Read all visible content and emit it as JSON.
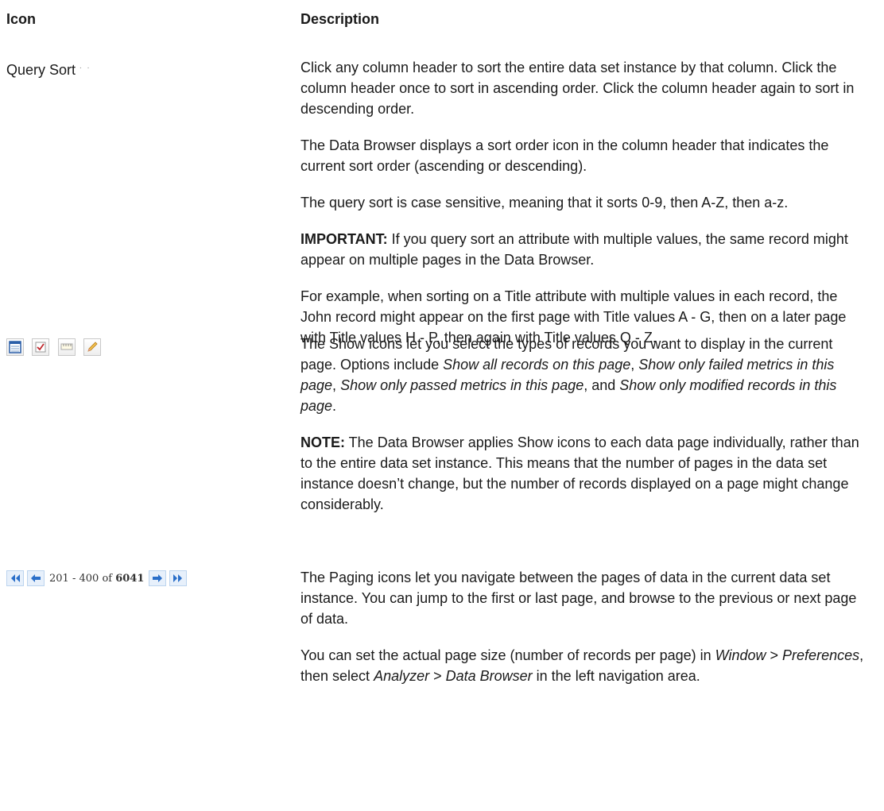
{
  "header": {
    "icon": "Icon",
    "description": "Description"
  },
  "rows": [
    {
      "label": "Query Sort",
      "paragraphs": [
        "Click any column header to sort the entire data set instance by that column. Click the column header once to sort in ascending order. Click the column header again to sort in descending order.",
        "The Data Browser displays a sort order icon in the column header that indicates the current sort order (ascending or descending).",
        "The query sort is case sensitive, meaning that it sorts 0-9, then A-Z, then a-z."
      ],
      "important_label": "IMPORTANT:",
      "important_text": " If you query sort an attribute with multiple values, the same record might appear on multiple pages in the Data Browser.",
      "example": "For example, when sorting on a Title attribute with multiple values in each record, the John record might appear on the first page with Title values A - G, then on a later page with Title values H - P, then again with Title values Q - Z."
    },
    {
      "icons": [
        "show-all-records-icon",
        "show-failed-metrics-icon",
        "show-passed-metrics-icon",
        "show-modified-records-icon"
      ],
      "p1_a": "The Show icons let you select the types of records you want to display in the current page. Options include ",
      "p1_i1": "Show all records on this page",
      "p1_b": ", ",
      "p1_i2": "Show only failed metrics in this page",
      "p1_c": ", ",
      "p1_i3": "Show only passed metrics in this page",
      "p1_d": ", and ",
      "p1_i4": "Show only modified records in this page",
      "p1_e": ".",
      "note_label": "NOTE:",
      "note_text": " The Data Browser applies Show icons to each data page individually, rather than to the entire data set instance. This means that the number of pages in the data set instance doesn’t change, but the number of records displayed on a page might change considerably."
    },
    {
      "pager": {
        "range": "201 - 400",
        "of": "of",
        "total": "6041"
      },
      "p1": "The Paging icons let you navigate between the pages of data in the current data set instance. You can jump to the first or last page, and browse to the previous or next page of data.",
      "p2_a": "You can set the actual page size (number of records per page) in ",
      "p2_i1": "Window",
      "p2_b": " > ",
      "p2_i2": "Preferences",
      "p2_c": ", then select ",
      "p2_i3": "Analyzer",
      "p2_d": " > ",
      "p2_i4": "Data Browser",
      "p2_e": " in the left navigation area."
    }
  ]
}
